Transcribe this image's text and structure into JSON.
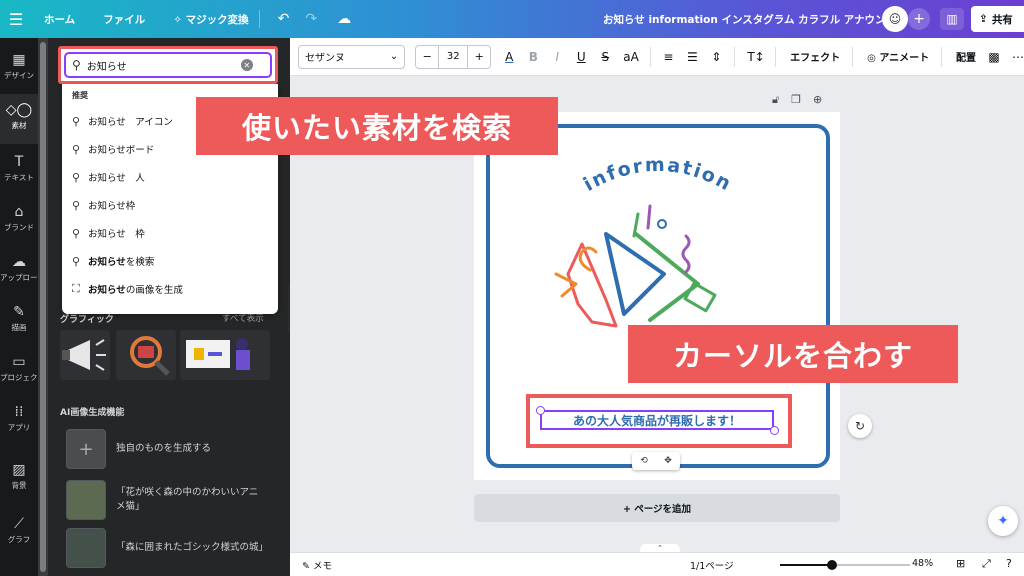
{
  "topbar": {
    "home": "ホーム",
    "file": "ファイル",
    "magic": "マジック変換",
    "doc_title": "お知らせ information インスタグラム カラフル アナウンス",
    "share": "共有"
  },
  "rail": [
    {
      "label": "デザイン",
      "icon": "layout-icon"
    },
    {
      "label": "素材",
      "icon": "elements-icon"
    },
    {
      "label": "テキスト",
      "icon": "text-icon"
    },
    {
      "label": "ブランド",
      "icon": "brand-icon"
    },
    {
      "label": "アップロード",
      "icon": "upload-icon"
    },
    {
      "label": "描画",
      "icon": "draw-icon"
    },
    {
      "label": "プロジェクト",
      "icon": "folder-icon"
    },
    {
      "label": "アプリ",
      "icon": "apps-icon"
    },
    {
      "label": "背景",
      "icon": "background-icon"
    },
    {
      "label": "グラフ",
      "icon": "chart-icon"
    }
  ],
  "search": {
    "value": "お知らせ",
    "dropdown_header": "推奨",
    "suggestions": [
      "お知らせ　アイコン",
      "お知らせボード",
      "お知らせ　人",
      "お知らせ枠",
      "お知らせ　枠"
    ],
    "search_action_bold": "お知らせ",
    "search_action_rest": "を検索",
    "generate_action_bold": "お知らせ",
    "generate_action_rest": "の画像を生成"
  },
  "panel": {
    "graphics_label": "グラフィック",
    "see_all": "すべて表示",
    "ai_label": "AI画像生成機能",
    "gen_own": "独自のものを生成する",
    "gen_1": "「花が咲く森の中のかわいいアニメ猫」",
    "gen_2": "「森に囲まれたゴシック様式の城」"
  },
  "callouts": {
    "search": "使いたい素材を検索",
    "cursor": "カーソルを合わす"
  },
  "toolbar": {
    "font": "セザンヌ",
    "size": "32",
    "effect": "エフェクト",
    "animate": "アニメート",
    "arrange": "配置"
  },
  "canvas": {
    "info": "information",
    "caption": "あの大人気商品が再販します！",
    "add_page": "+ ページを追加"
  },
  "bottombar": {
    "notes": "メモ",
    "pages": "1/1ページ",
    "zoom": "48%",
    "zoom_value": 48
  },
  "colors": {
    "accent": "#8b3dff",
    "callout": "#ee5a5a",
    "frame": "#2e6db0"
  }
}
